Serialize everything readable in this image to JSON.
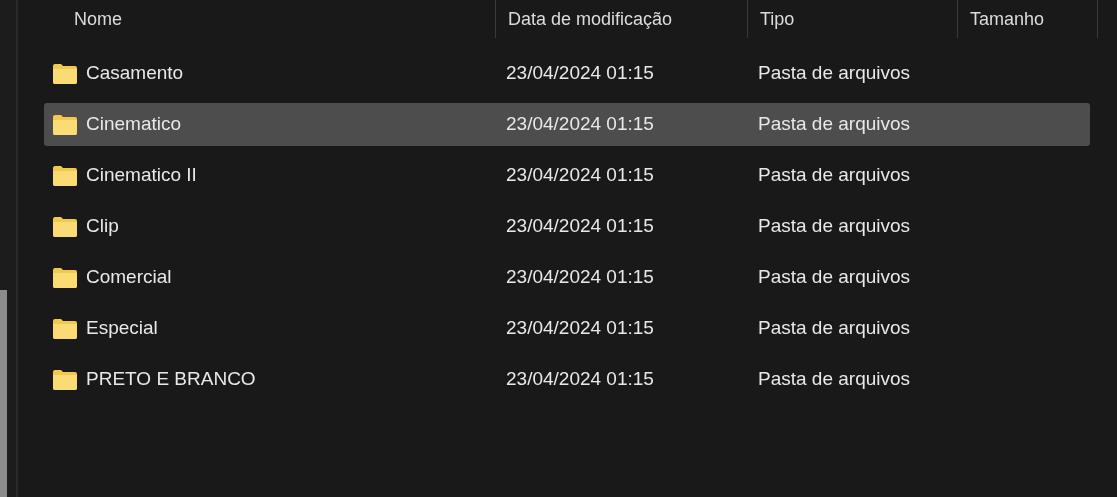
{
  "columns": [
    "Nome",
    "Data de modificação",
    "Tipo",
    "Tamanho"
  ],
  "rows": [
    {
      "name": "Casamento",
      "modified": "23/04/2024 01:15",
      "type": "Pasta de arquivos",
      "selected": false
    },
    {
      "name": "Cinematico",
      "modified": "23/04/2024 01:15",
      "type": "Pasta de arquivos",
      "selected": true
    },
    {
      "name": "Cinematico II",
      "modified": "23/04/2024 01:15",
      "type": "Pasta de arquivos",
      "selected": false
    },
    {
      "name": "Clip",
      "modified": "23/04/2024 01:15",
      "type": "Pasta de arquivos",
      "selected": false
    },
    {
      "name": "Comercial",
      "modified": "23/04/2024 01:15",
      "type": "Pasta de arquivos",
      "selected": false
    },
    {
      "name": "Especial",
      "modified": "23/04/2024 01:15",
      "type": "Pasta de arquivos",
      "selected": false
    },
    {
      "name": "PRETO E BRANCO",
      "modified": "23/04/2024 01:15",
      "type": "Pasta de arquivos",
      "selected": false
    }
  ]
}
